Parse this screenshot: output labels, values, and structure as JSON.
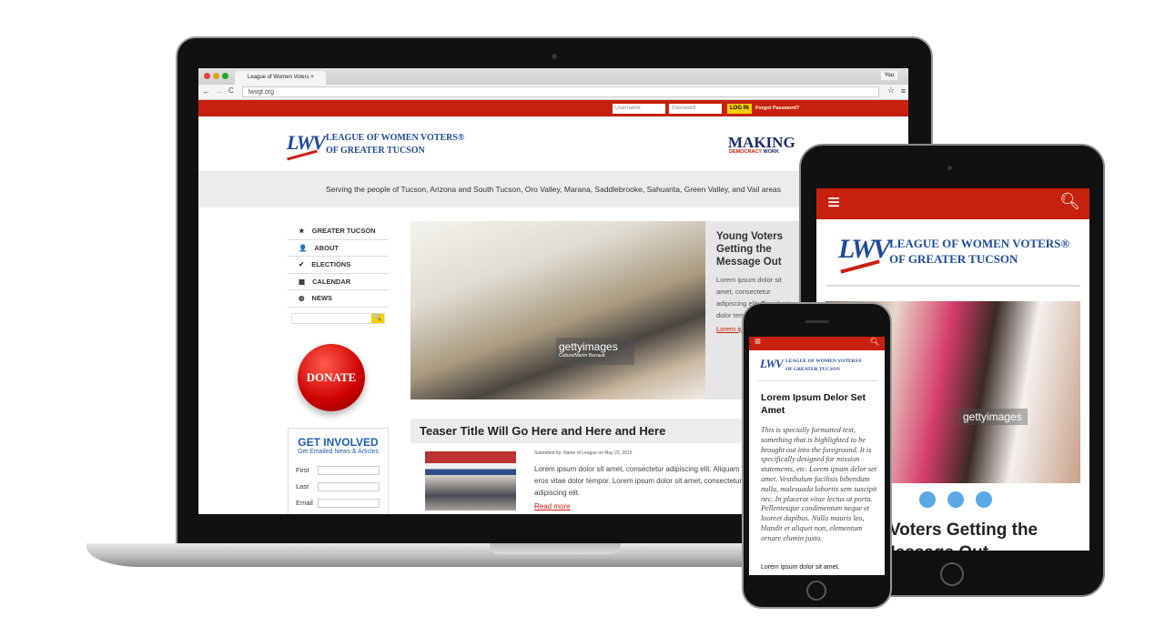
{
  "browser": {
    "tab_title": "League of Women Voters",
    "url": "lwvgt.org",
    "profile": "You"
  },
  "site": {
    "login": {
      "username_placeholder": "Username",
      "password_placeholder": "Password",
      "login_label": "LOG IN",
      "forgot_label": "Forgot Password?"
    },
    "logo": {
      "mark": "LWV",
      "line1": "LEAGUE OF WOMEN VOTERS®",
      "line2": "OF GREATER TUCSON"
    },
    "slogan": {
      "line1": "MAKING",
      "line2a": "DEMOCRACY",
      "line2b": "WORK"
    },
    "tagline": "Serving the people of Tucson, Arizona and South Tucson, Oro Valley, Marana, Saddlebrooke, Sahuarita, Green Valley, and Vail areas",
    "nav": [
      {
        "label": "GREATER TUCSON",
        "icon": "star-icon"
      },
      {
        "label": "ABOUT",
        "icon": "person-icon"
      },
      {
        "label": "ELECTIONS",
        "icon": "check-icon"
      },
      {
        "label": "CALENDAR",
        "icon": "calendar-icon"
      },
      {
        "label": "NEWS",
        "icon": "globe-icon"
      }
    ],
    "donate": "DONATE",
    "get_involved": {
      "title": "GET INVOLVED",
      "subtitle": "Get Emailed News & Articles",
      "fields": [
        "First",
        "Last",
        "Email"
      ]
    },
    "hero": {
      "title": "Young Voters Getting the Message Out",
      "text": "Lorem ipsum dolor sit amet, consectetur adipiscing elit. Tincidunt dolor tempor.",
      "link": "Lorem ipsum",
      "watermark": "gettyimages",
      "credit": "Cultura/Martin Barraud"
    },
    "teaser": {
      "title": "Teaser Title Will Go Here and Here and Here",
      "meta": "Submitted by: Name of League on May 22, 2015",
      "body": "Lorem ipsum dolor sit amet, consectetur adipiscing elit. Aliquam tincidunt eros vitae dolor tempor. Lorem ipsum dolor sit amet, consectetur adipiscing elit.",
      "read_more": "Read more"
    }
  },
  "tablet": {
    "hero_title": "Young Voters Getting the Message Out",
    "watermark": "gettyimages",
    "slides": 3,
    "active_slide": 1
  },
  "phone": {
    "title": "Lorem Ipsum Delor Set Amet",
    "intro": "This is specially formatted text, something that is highlighted to be brought out into the foreground. It is specifically designed for mission statements, etc. Lorem ipsum delor set amet. Vestibulum facilisis bibendum nulla, malesuada lobortis sem suscipit nec. In placerat vitae lectus ut porta. Pellentesque condimentum neque et laoreet dapibus. Nulla mauris leo, blandit et aliquet non, elementum ornare elumin justo.",
    "body": "Lorem ipsum dolor sit amet."
  },
  "colors": {
    "brand_red": "#c8200f",
    "brand_blue": "#1f4a9a",
    "login_yellow": "#f5d000",
    "slide_dot": "#5aa9e6"
  }
}
